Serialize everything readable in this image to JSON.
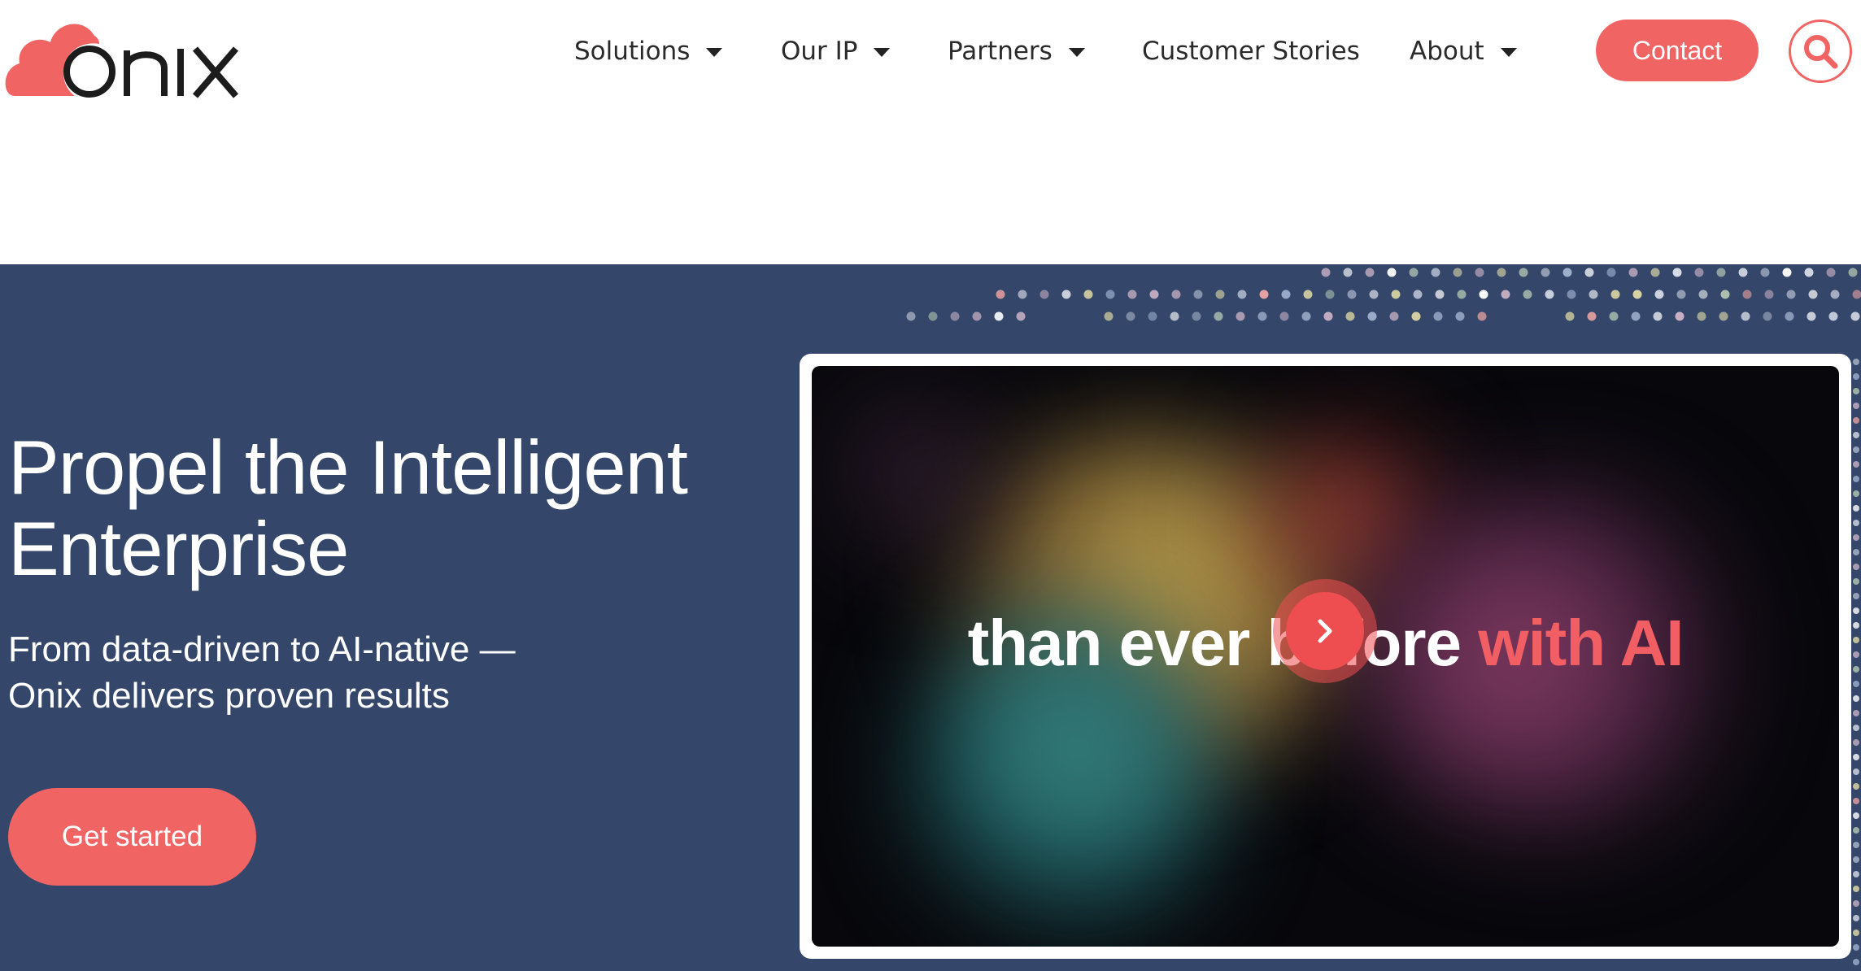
{
  "brand": {
    "logo_text": "onix",
    "accent_color": "#f16464",
    "hero_bg": "#34476a"
  },
  "nav": {
    "items": [
      {
        "label": "Solutions",
        "has_dropdown": true
      },
      {
        "label": "Our IP",
        "has_dropdown": true
      },
      {
        "label": "Partners",
        "has_dropdown": true
      },
      {
        "label": "Customer Stories",
        "has_dropdown": false
      },
      {
        "label": "About",
        "has_dropdown": true
      }
    ],
    "contact_label": "Contact",
    "search_icon": "search-icon"
  },
  "hero": {
    "title": "Propel the Intelligent Enterprise",
    "subtitle": "From data-driven to AI-native — Onix delivers proven results",
    "cta_label": "Get started",
    "video": {
      "caption_main": "than ever b",
      "caption_hidden": "e",
      "caption_tail": "fore ",
      "caption_accent": "with AI",
      "play_icon": "chevron-right-icon"
    }
  }
}
